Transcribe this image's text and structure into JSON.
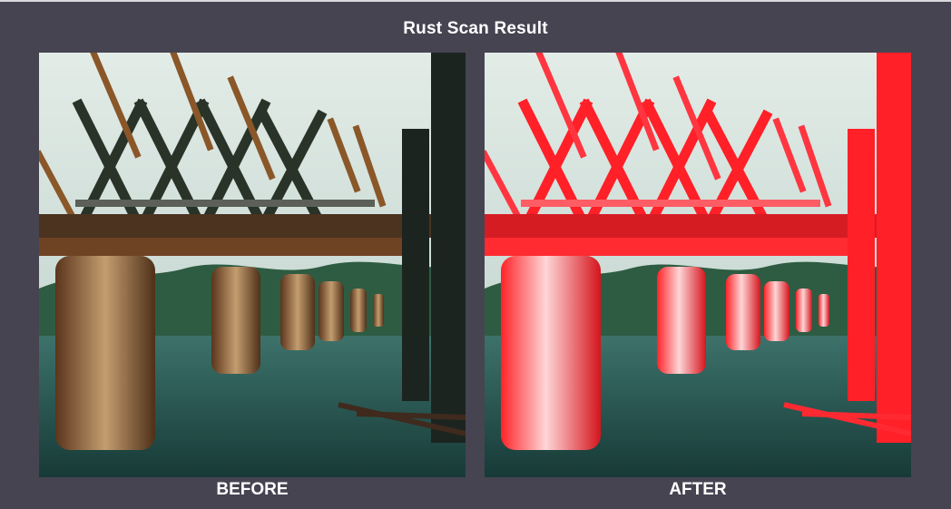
{
  "title": "Rust Scan Result",
  "panels": {
    "before": {
      "label": "BEFORE"
    },
    "after": {
      "label": "AFTER"
    }
  },
  "colors": {
    "background": "#464451",
    "water": "#23544f",
    "sky": "#d8e6e0",
    "rust": "#9b5a24",
    "steel": "#3a3b33",
    "highlight": "#ff2028"
  }
}
